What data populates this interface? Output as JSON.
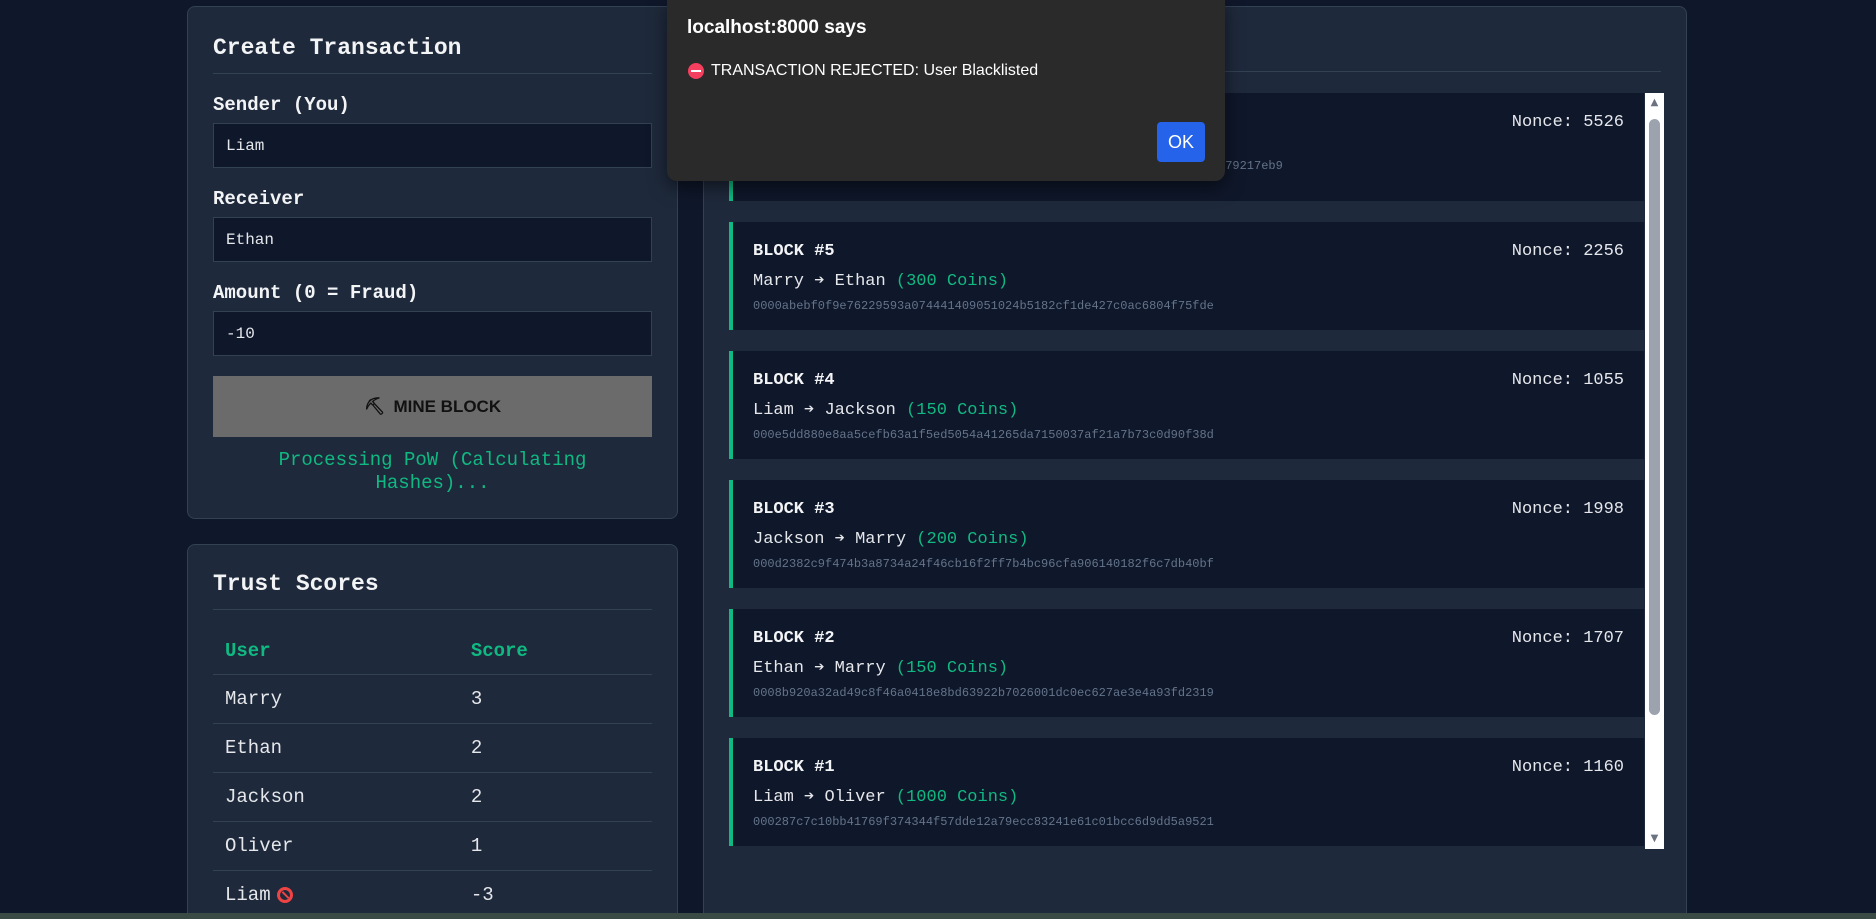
{
  "create": {
    "title": "Create Transaction",
    "sender_label": "Sender (You)",
    "sender_value": "Liam",
    "receiver_label": "Receiver",
    "receiver_value": "Ethan",
    "amount_label": "Amount (0 = Fraud)",
    "amount_value": "-10",
    "mine_button_label": "MINE BLOCK",
    "mine_icon": "pickaxe-icon",
    "status": "Processing PoW (Calculating Hashes)..."
  },
  "trust": {
    "title": "Trust Scores",
    "col_user": "User",
    "col_score": "Score",
    "rows": [
      {
        "user": "Marry",
        "score": "3"
      },
      {
        "user": "Ethan",
        "score": "2"
      },
      {
        "user": "Jackson",
        "score": "2"
      },
      {
        "user": "Oliver",
        "score": "1"
      },
      {
        "user": "Liam",
        "score": "-3",
        "banned": true
      }
    ]
  },
  "blocks": [
    {
      "title": "",
      "nonce": "Nonce: 5526",
      "from": "",
      "to": "",
      "amount": "",
      "hash": "379217eb9"
    },
    {
      "title": "BLOCK #5",
      "nonce": "Nonce: 2256",
      "from": "Marry",
      "to": "Ethan",
      "amount": "(300 Coins)",
      "hash": "0000abebf0f9e76229593a074441409051024b5182cf1de427c0ac6804f75fde"
    },
    {
      "title": "BLOCK #4",
      "nonce": "Nonce: 1055",
      "from": "Liam",
      "to": "Jackson",
      "amount": "(150 Coins)",
      "hash": "000e5dd880e8aa5cefb63a1f5ed5054a41265da7150037af21a7b73c0d90f38d"
    },
    {
      "title": "BLOCK #3",
      "nonce": "Nonce: 1998",
      "from": "Jackson",
      "to": "Marry",
      "amount": "(200 Coins)",
      "hash": "000d2382c9f474b3a8734a24f46cb16f2ff7b4bc96cfa906140182f6c7db40bf"
    },
    {
      "title": "BLOCK #2",
      "nonce": "Nonce: 1707",
      "from": "Ethan",
      "to": "Marry",
      "amount": "(150 Coins)",
      "hash": "0008b920a32ad49c8f46a0418e8bd63922b7026001dc0ec627ae3e4a93fd2319"
    },
    {
      "title": "BLOCK #1",
      "nonce": "Nonce: 1160",
      "from": "Liam",
      "to": "Oliver",
      "amount": "(1000 Coins)",
      "hash": "000287c7c10bb41769f374344f57dde12a79ecc83241e61c01bcc6d9dd5a9521"
    }
  ],
  "arrow": "➔",
  "dialog": {
    "title": "localhost:8000 says",
    "message": "TRANSACTION REJECTED: User Blacklisted",
    "ok_label": "OK"
  },
  "colors": {
    "accent": "#10b981",
    "danger": "#ef4444",
    "background": "#0f172a",
    "card": "#1e293b",
    "dialog_button": "#2563eb"
  }
}
